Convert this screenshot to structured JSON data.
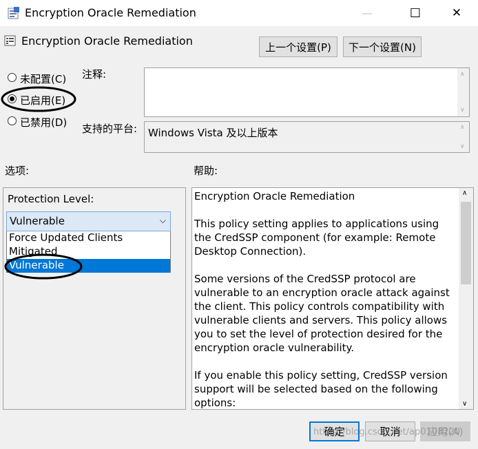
{
  "window": {
    "title": "Encryption Oracle Remediation",
    "minimize_glyph": "—",
    "maximize_glyph": "☐",
    "close_glyph": "✕"
  },
  "header": {
    "setting_name": "Encryption Oracle Remediation",
    "prev_label": "上一个设置(P)",
    "next_label": "下一个设置(N)"
  },
  "state": {
    "options": [
      {
        "label": "未配置(C)",
        "selected": false
      },
      {
        "label": "已启用(E)",
        "selected": true
      },
      {
        "label": "已禁用(D)",
        "selected": false
      }
    ]
  },
  "comment": {
    "label": "注释:",
    "value": ""
  },
  "platform": {
    "label": "支持的平台:",
    "value": "Windows Vista 及以上版本"
  },
  "options_section": {
    "label": "选项:",
    "protection_label": "Protection Level:",
    "selected": "Vulnerable",
    "dropdown_items": [
      "Force Updated Clients",
      "Mitigated",
      "Vulnerable"
    ],
    "highlighted_index": 2
  },
  "help_section": {
    "label": "帮助:",
    "paragraphs": [
      "Encryption Oracle Remediation",
      "This policy setting applies to applications using the CredSSP component (for example: Remote Desktop Connection).",
      "Some versions of the CredSSP protocol are vulnerable to an encryption oracle attack against the client.  This policy controls compatibility with vulnerable clients and servers. This policy allows you to set the level of protection desired for the encryption oracle vulnerability.",
      "If you enable this policy setting, CredSSP version support will be selected based on the following options:"
    ]
  },
  "footer": {
    "ok_label": "确定",
    "cancel_label": "取消",
    "apply_label": "应用(A)",
    "watermark": "https://blog.csdn.net/ap0108220"
  },
  "colors": {
    "accent": "#0078d7",
    "highlight": "#0078d7"
  }
}
